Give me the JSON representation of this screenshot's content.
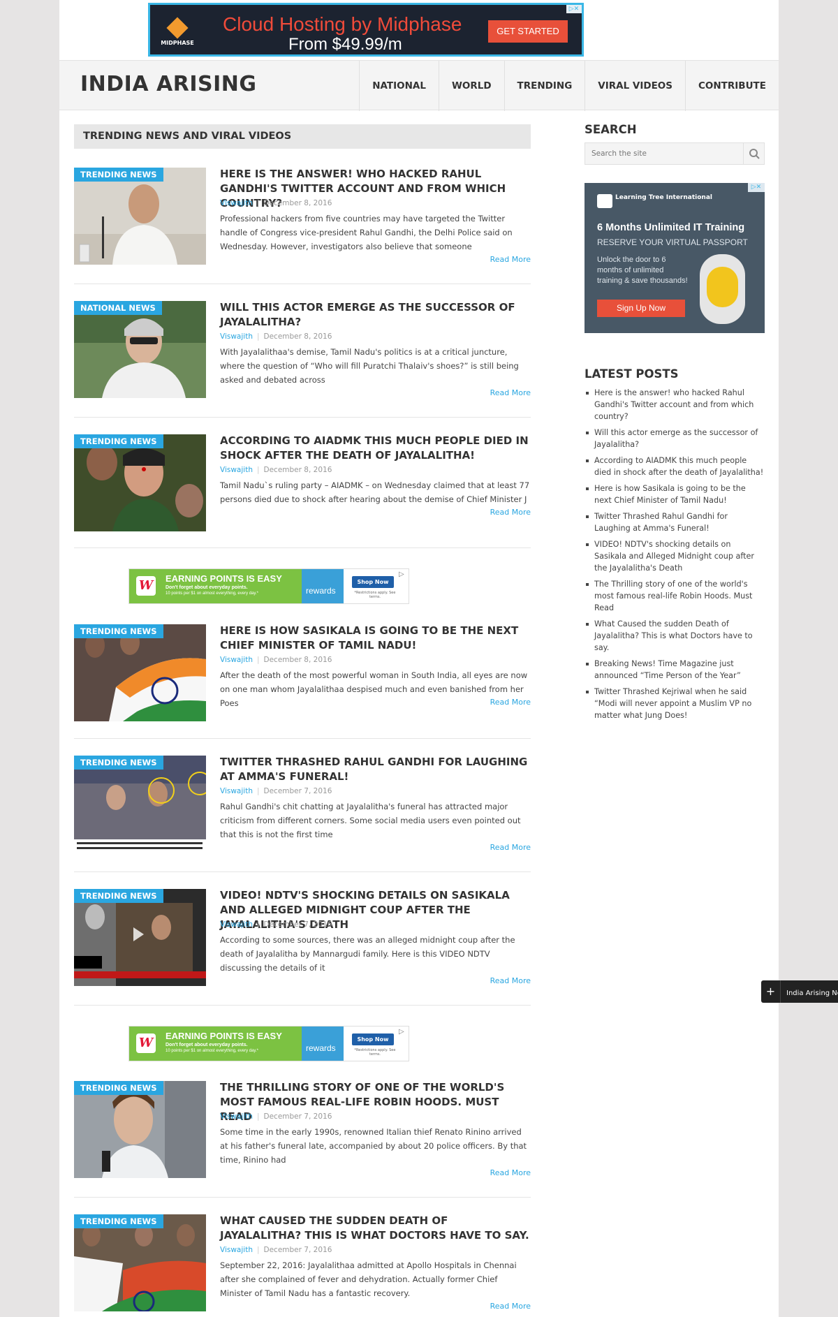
{
  "top_ad": {
    "brand": "MIDPHASE",
    "headline": "Cloud Hosting by Midphase",
    "subline": "From $49.99/m",
    "cta": "GET STARTED"
  },
  "site": {
    "title": "INDIA ARISING",
    "nav": [
      "NATIONAL",
      "WORLD",
      "TRENDING",
      "VIRAL VIDEOS",
      "CONTRIBUTE"
    ]
  },
  "main": {
    "section_title": "TRENDING NEWS AND VIRAL VIDEOS",
    "read_more": "Read More",
    "articles": [
      {
        "badge": "TRENDING NEWS",
        "title": "HERE IS THE ANSWER! WHO HACKED RAHUL GANDHI'S TWITTER ACCOUNT AND FROM WHICH COUNTRY?",
        "author": "Viswajith",
        "date": "December 8, 2016",
        "excerpt": "Professional hackers from five countries may have targeted the Twitter handle of Congress vice-president Rahul Gandhi, the Delhi Police said on Wednesday. However, investigators also believe that someone"
      },
      {
        "badge": "NATIONAL NEWS",
        "title": "WILL THIS ACTOR EMERGE AS THE SUCCESSOR OF JAYALALITHA?",
        "author": "Viswajith",
        "date": "December 8, 2016",
        "excerpt": "With Jayalalithaa's demise, Tamil Nadu's politics is at a critical juncture, where the question of “Who will fill Puratchi Thalaiv's shoes?” is still being asked and debated across"
      },
      {
        "badge": "TRENDING NEWS",
        "title": "ACCORDING TO AIADMK THIS MUCH PEOPLE DIED IN SHOCK AFTER THE DEATH OF JAYALALITHA!",
        "author": "Viswajith",
        "date": "December 8, 2016",
        "excerpt": "Tamil Nadu`s ruling party – AIADMK – on Wednesday claimed that at least 77 persons died due to shock after hearing about the demise of Chief Minister J"
      },
      {
        "badge": "TRENDING NEWS",
        "title": "HERE IS HOW SASIKALA IS GOING TO BE THE NEXT CHIEF MINISTER OF TAMIL NADU!",
        "author": "Viswajith",
        "date": "December 8, 2016",
        "excerpt": "After the death of the most powerful woman in South India, all eyes are now on one man whom Jayalalithaa despised much and even banished from her Poes"
      },
      {
        "badge": "TRENDING NEWS",
        "title": "TWITTER THRASHED RAHUL GANDHI FOR LAUGHING AT AMMA'S FUNERAL!",
        "author": "Viswajith",
        "date": "December 7, 2016",
        "excerpt": "Rahul Gandhi's chit chatting at Jayalalitha's funeral has attracted major criticism from different corners. Some social media users even pointed out that this is not the first time"
      },
      {
        "badge": "TRENDING NEWS",
        "title": "VIDEO! NDTV'S SHOCKING DETAILS ON SASIKALA AND ALLEGED MIDNIGHT COUP AFTER THE JAYALALITHA'S DEATH",
        "author": "Viswajith",
        "date": "December 7, 2016",
        "excerpt": "According to some sources, there was an alleged midnight coup after the death of Jayalalitha by Mannargudi family. Here is this VIDEO NDTV discussing the details of it"
      },
      {
        "badge": "TRENDING NEWS",
        "title": "THE THRILLING STORY OF ONE OF THE WORLD'S MOST FAMOUS REAL-LIFE ROBIN HOODS. MUST READ",
        "author": "Viswajith",
        "date": "December 7, 2016",
        "excerpt": "Some time in the early 1990s, renowned Italian thief Renato Rinino arrived at his father's funeral late, accompanied by about 20 police officers. By that time, Rinino had"
      },
      {
        "badge": "TRENDING NEWS",
        "title": "WHAT CAUSED THE SUDDEN DEATH OF JAYALALITHA? THIS IS WHAT DOCTORS HAVE TO SAY.",
        "author": "Viswajith",
        "date": "December 7, 2016",
        "excerpt": "September 22, 2016: Jayalalithaa admitted at Apollo Hospitals in Chennai after she complained of fever and dehydration. Actually former Chief Minister of Tamil Nadu has a fantastic recovery."
      }
    ]
  },
  "inline_ad": {
    "logo": "W",
    "headline": "EARNING POINTS IS EASY",
    "line1": "Don't forget about everyday points.",
    "line2": "10 points per $1 on almost everything, every day.*",
    "brand": "rewards",
    "cta": "Shop Now",
    "fine": "*Restrictions apply. See terms."
  },
  "sidebar": {
    "search_heading": "SEARCH",
    "search_placeholder": "Search the site",
    "ad": {
      "logo": "Learning Tree International",
      "headline": "6 Months Unlimited IT Training",
      "subline": "RESERVE YOUR VIRTUAL PASSPORT",
      "body": "Unlock the door to 6 months of unlimited training & save thousands!",
      "cta": "Sign Up Now"
    },
    "latest_heading": "LATEST POSTS",
    "latest_posts": [
      "Here is the answer! who hacked Rahul Gandhi's Twitter account and from which country?",
      "Will this actor emerge as the successor of Jayalalitha?",
      "According to AIADMK this much people died in shock after the death of Jayalalitha!",
      "Here is how Sasikala is going to be the next Chief Minister of Tamil Nadu!",
      "Twitter Thrashed Rahul Gandhi for Laughing at Amma's Funeral!",
      "VIDEO! NDTV's shocking details on Sasikala and Alleged Midnight coup after the Jayalalitha's Death",
      "The Thrilling story of one of the world's most famous real-life Robin Hoods. Must Read",
      "What Caused the sudden Death of Jayalalitha? This is what Doctors have to say.",
      "Breaking News! Time Magazine just announced “Time Person of the Year”",
      "Twitter Thrashed Kejriwal when he said “Modi will never appoint a Muslim VP no matter what Jung Does!"
    ]
  },
  "floating_widget": {
    "label": "India Arising Ne"
  },
  "colors": {
    "accent": "#2aa6e0",
    "header_bg": "#f4f4f4",
    "page_bg": "#e6e4e4"
  }
}
